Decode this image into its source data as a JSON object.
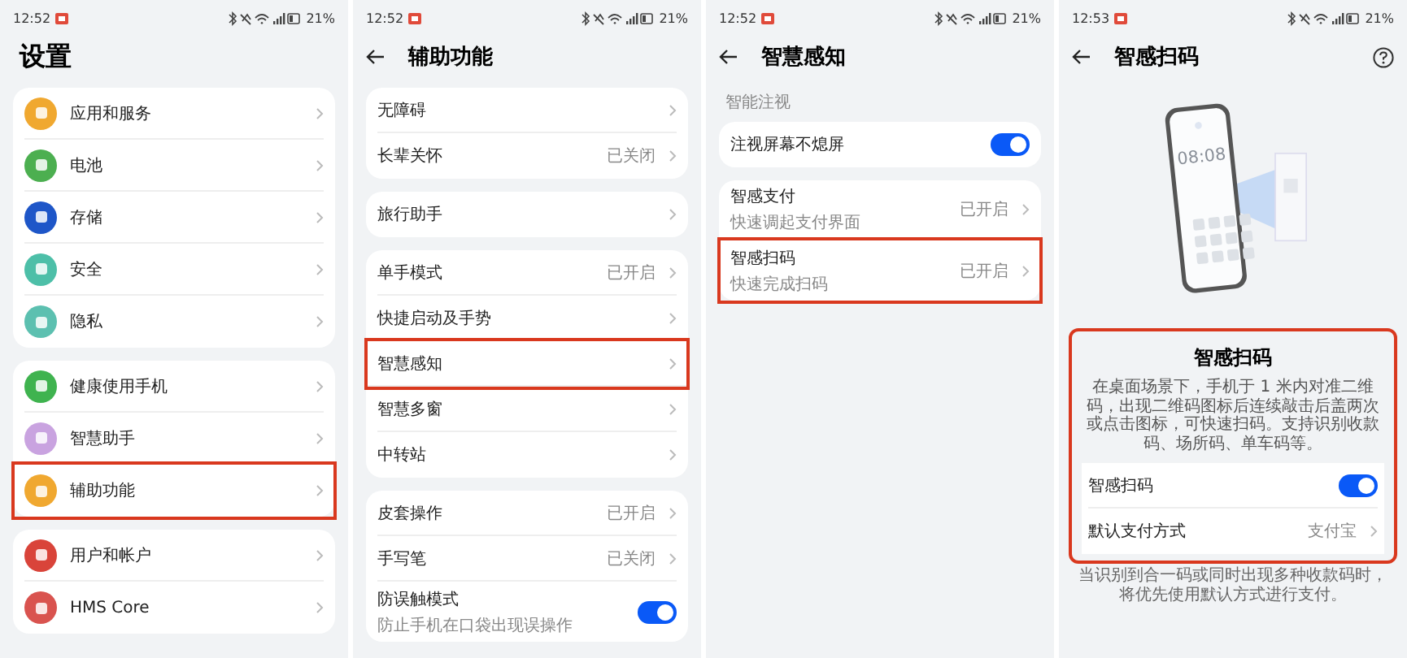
{
  "screens": [
    {
      "status": {
        "time": "12:52",
        "battery": "21%"
      },
      "header": {
        "kind": "large",
        "title": "设置",
        "help": false
      },
      "groups": [
        {
          "rows": [
            {
              "label": "应用和服务",
              "color": "#f0a830",
              "kind": "chevron",
              "highlighted": false
            },
            {
              "label": "电池",
              "color": "#4caf50",
              "kind": "chevron",
              "highlighted": false
            },
            {
              "label": "存储",
              "color": "#1e56c8",
              "kind": "chevron",
              "highlighted": false
            },
            {
              "label": "安全",
              "color": "#4dbfa8",
              "kind": "chevron",
              "highlighted": false
            },
            {
              "label": "隐私",
              "color": "#5cc0b0",
              "kind": "chevron",
              "highlighted": false
            }
          ]
        },
        {
          "rows": [
            {
              "label": "健康使用手机",
              "color": "#3fb34f",
              "kind": "chevron",
              "highlighted": false
            },
            {
              "label": "智慧助手",
              "color": "#c9a3e0",
              "kind": "chevron",
              "highlighted": false
            },
            {
              "label": "辅助功能",
              "color": "#f0a830",
              "kind": "chevron",
              "highlighted": true
            }
          ]
        },
        {
          "rows": [
            {
              "label": "用户和帐户",
              "color": "#d9443a",
              "kind": "chevron",
              "highlighted": false
            },
            {
              "label": "HMS Core",
              "color": "#d9534f",
              "kind": "chevron",
              "highlighted": false
            }
          ]
        }
      ]
    },
    {
      "status": {
        "time": "12:52",
        "battery": "21%"
      },
      "header": {
        "kind": "nav",
        "title": "辅助功能",
        "help": false
      },
      "groups": [
        {
          "rows": [
            {
              "label": "无障碍",
              "kind": "chevron",
              "highlighted": false
            },
            {
              "label": "长辈关怀",
              "value": "已关闭",
              "kind": "chevron",
              "highlighted": false
            }
          ]
        },
        {
          "rows": [
            {
              "label": "旅行助手",
              "kind": "chevron",
              "highlighted": false
            }
          ]
        },
        {
          "rows": [
            {
              "label": "单手模式",
              "value": "已开启",
              "kind": "chevron",
              "highlighted": false
            },
            {
              "label": "快捷启动及手势",
              "kind": "chevron",
              "highlighted": false
            },
            {
              "label": "智慧感知",
              "kind": "chevron",
              "highlighted": true
            },
            {
              "label": "智慧多窗",
              "kind": "chevron",
              "highlighted": false
            },
            {
              "label": "中转站",
              "kind": "chevron",
              "highlighted": false
            }
          ]
        },
        {
          "rows": [
            {
              "label": "皮套操作",
              "value": "已开启",
              "kind": "chevron",
              "highlighted": false
            },
            {
              "label": "手写笔",
              "value": "已关闭",
              "kind": "chevron",
              "highlighted": false
            },
            {
              "label": "防误触模式",
              "sub": "防止手机在口袋出现误操作",
              "kind": "toggle",
              "on": true,
              "highlighted": false
            }
          ]
        }
      ]
    },
    {
      "status": {
        "time": "12:52",
        "battery": "21%"
      },
      "header": {
        "kind": "nav",
        "title": "智慧感知",
        "help": false
      },
      "groups": [
        {
          "caption": "智能注视",
          "rows": [
            {
              "label": "注视屏幕不熄屏",
              "kind": "toggle",
              "on": true,
              "highlighted": false
            }
          ]
        },
        {
          "rows": [
            {
              "label": "智感支付",
              "sub": "快速调起支付界面",
              "value": "已开启",
              "kind": "chevron",
              "highlighted": false
            },
            {
              "label": "智感扫码",
              "sub": "快速完成扫码",
              "value": "已开启",
              "kind": "chevron",
              "highlighted": true
            }
          ]
        }
      ]
    },
    {
      "status": {
        "time": "12:53",
        "battery": "21%"
      },
      "header": {
        "kind": "nav",
        "title": "智感扫码",
        "help": true
      },
      "illustration": {
        "clock": "08:08"
      },
      "card": {
        "highlighted": true,
        "title": "智感扫码",
        "description": "在桌面场景下，手机于 1 米内对准二维码，出现二维码图标后连续敲击后盖两次或点击图标，可快速扫码。支持识别收款码、场所码、单车码等。",
        "rows": [
          {
            "label": "智感扫码",
            "kind": "toggle",
            "on": true,
            "highlighted": false
          },
          {
            "label": "默认支付方式",
            "value": "支付宝",
            "kind": "chevron",
            "highlighted": false
          }
        ]
      },
      "footnote": "当识别到合一码或同时出现多种收款码时，将优先使用默认方式进行支付。"
    }
  ]
}
